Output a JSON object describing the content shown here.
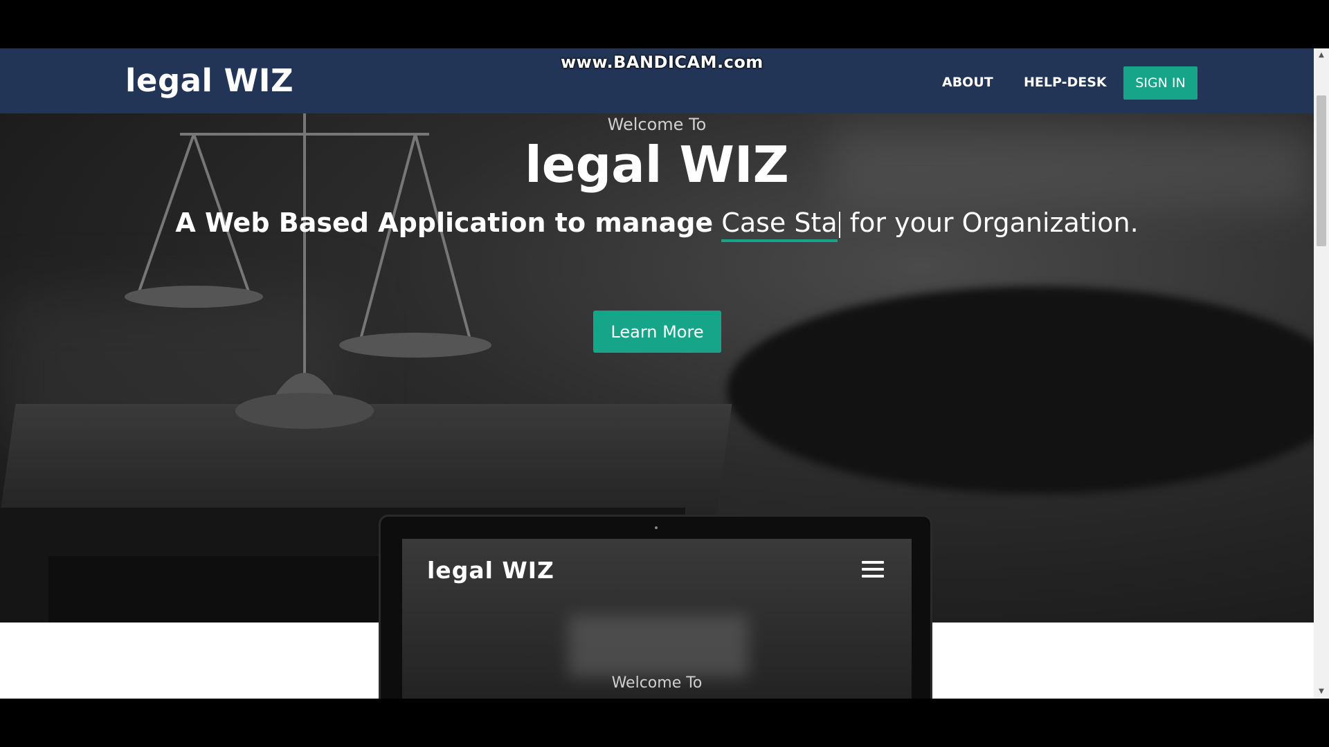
{
  "watermark": "www.BANDICAM.com",
  "navbar": {
    "brand": "legal WIZ",
    "links": [
      "ABOUT",
      "HELP-DESK"
    ],
    "signin": "SIGN IN"
  },
  "hero": {
    "welcome": "Welcome To",
    "title": "legal WIZ",
    "tagline_bold": "A Web Based Application to manage",
    "typed_text": "Case Sta",
    "tagline_rest": "for your Organization.",
    "button": "Learn More"
  },
  "laptop": {
    "brand": "legal WIZ",
    "welcome": "Welcome To",
    "menu_icon": "hamburger-icon"
  },
  "colors": {
    "navbar": "#233556",
    "accent": "#17a589"
  }
}
